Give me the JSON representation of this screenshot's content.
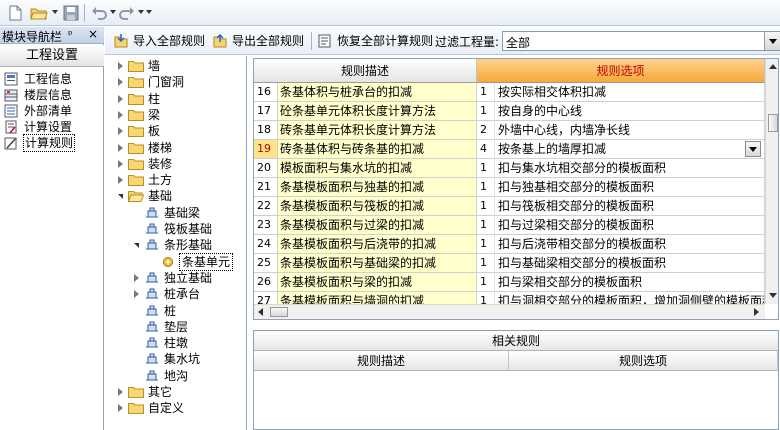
{
  "toolbar": {
    "icons": [
      "new-file-icon",
      "open-folder-icon",
      "save-icon",
      "undo-icon",
      "redo-icon",
      "customize-icon"
    ]
  },
  "nav": {
    "header_title": "模块导航栏",
    "pin_glyph": "ᵖ",
    "close_glyph": "×",
    "section_title": "工程设置",
    "items": [
      {
        "label": "工程信息",
        "icon": "project-info-icon"
      },
      {
        "label": "楼层信息",
        "icon": "floor-info-icon"
      },
      {
        "label": "外部清单",
        "icon": "external-list-icon"
      },
      {
        "label": "计算设置",
        "icon": "calc-settings-icon"
      },
      {
        "label": "计算规则",
        "icon": "calc-rules-icon",
        "selected": true
      }
    ]
  },
  "rule_toolbar": {
    "import_label": "导入全部规则",
    "export_label": "导出全部规则",
    "restore_label": "恢复全部计算规则",
    "filter_label": "过滤工程量:",
    "filter_value": "全部"
  },
  "tree": {
    "nodes": [
      {
        "label": "墙",
        "level": 0,
        "state": "closed",
        "icon": "folder-icon"
      },
      {
        "label": "门窗洞",
        "level": 0,
        "state": "closed",
        "icon": "folder-icon"
      },
      {
        "label": "柱",
        "level": 0,
        "state": "closed",
        "icon": "folder-icon"
      },
      {
        "label": "梁",
        "level": 0,
        "state": "closed",
        "icon": "folder-icon"
      },
      {
        "label": "板",
        "level": 0,
        "state": "closed",
        "icon": "folder-icon"
      },
      {
        "label": "楼梯",
        "level": 0,
        "state": "closed",
        "icon": "folder-icon"
      },
      {
        "label": "装修",
        "level": 0,
        "state": "closed",
        "icon": "folder-icon"
      },
      {
        "label": "土方",
        "level": 0,
        "state": "closed",
        "icon": "folder-icon"
      },
      {
        "label": "基础",
        "level": 0,
        "state": "open",
        "icon": "folder-open-icon"
      },
      {
        "label": "基础梁",
        "level": 1,
        "state": "none",
        "icon": "foundation-beam-icon"
      },
      {
        "label": "筏板基础",
        "level": 1,
        "state": "none",
        "icon": "raft-foundation-icon"
      },
      {
        "label": "条形基础",
        "level": 1,
        "state": "open",
        "icon": "strip-foundation-icon"
      },
      {
        "label": "条基单元",
        "level": 2,
        "state": "none",
        "icon": "gear-icon",
        "selected": true
      },
      {
        "label": "独立基础",
        "level": 1,
        "state": "closed",
        "icon": "isolated-foundation-icon"
      },
      {
        "label": "桩承台",
        "level": 1,
        "state": "closed",
        "icon": "pile-cap-icon"
      },
      {
        "label": "桩",
        "level": 1,
        "state": "none",
        "icon": "pile-icon"
      },
      {
        "label": "垫层",
        "level": 1,
        "state": "none",
        "icon": "cushion-icon"
      },
      {
        "label": "柱墩",
        "level": 1,
        "state": "none",
        "icon": "column-pier-icon"
      },
      {
        "label": "集水坑",
        "level": 1,
        "state": "none",
        "icon": "sump-pit-icon"
      },
      {
        "label": "地沟",
        "level": 1,
        "state": "none",
        "icon": "trench-icon"
      },
      {
        "label": "其它",
        "level": 0,
        "state": "closed",
        "icon": "folder-icon"
      },
      {
        "label": "自定义",
        "level": 0,
        "state": "closed",
        "icon": "folder-icon"
      }
    ]
  },
  "grid": {
    "col_desc": "规则描述",
    "col_option": "规则选项",
    "rows": [
      {
        "num": "16",
        "desc": "条基体积与桩承台的扣减",
        "opt_num": "1",
        "opt": "按实际相交体积扣减"
      },
      {
        "num": "17",
        "desc": "砼条基单元体积长度计算方法",
        "opt_num": "1",
        "opt": "按自身的中心线"
      },
      {
        "num": "18",
        "desc": "砖条基单元体积长度计算方法",
        "opt_num": "2",
        "opt": "外墙中心线，内墙净长线"
      },
      {
        "num": "19",
        "desc": "砖条基体积与砖条基的扣减",
        "opt_num": "4",
        "opt": "按条基上的墙厚扣减",
        "active": true
      },
      {
        "num": "20",
        "desc": "模板面积与集水坑的扣减",
        "opt_num": "1",
        "opt": "扣与集水坑相交部分的模板面积"
      },
      {
        "num": "21",
        "desc": "条基模板面积与独基的扣减",
        "opt_num": "1",
        "opt": "扣与独基相交部分的模板面积"
      },
      {
        "num": "22",
        "desc": "条基模板面积与筏板的扣减",
        "opt_num": "1",
        "opt": "扣与筏板相交部分的模板面积"
      },
      {
        "num": "23",
        "desc": "条基模板面积与过梁的扣减",
        "opt_num": "1",
        "opt": "扣与过梁相交部分的模板面积"
      },
      {
        "num": "24",
        "desc": "条基模板面积与后浇带的扣减",
        "opt_num": "1",
        "opt": "扣与后浇带相交部分的模板面积"
      },
      {
        "num": "25",
        "desc": "条基模板面积与基础梁的扣减",
        "opt_num": "1",
        "opt": "扣与基础梁相交部分的模板面积"
      },
      {
        "num": "26",
        "desc": "条基模板面积与梁的扣减",
        "opt_num": "1",
        "opt": "扣与梁相交部分的模板面积"
      },
      {
        "num": "27",
        "desc": "条基模板面积与墙洞的扣减",
        "opt_num": "1",
        "opt": "扣与洞相交部分的模板面积，增加洞侧壁的模板面积"
      }
    ]
  },
  "related": {
    "title": "相关规则",
    "col_desc": "规则描述",
    "col_option": "规则选项"
  },
  "colors": {
    "accent_header": "#f5a93b",
    "desc_cell_bg": "#ffffcc",
    "active_row_num": "#ffe38c",
    "header_text_red": "#c00000"
  }
}
